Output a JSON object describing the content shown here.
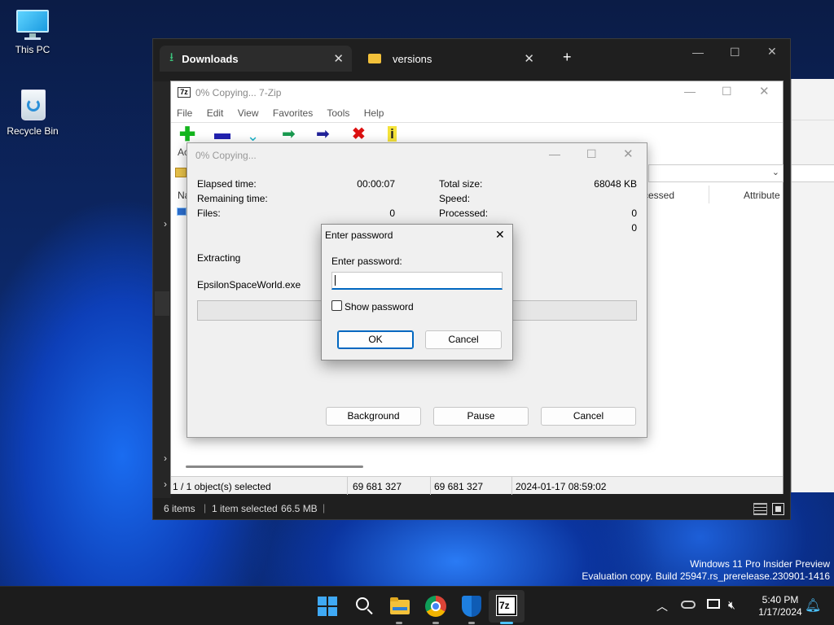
{
  "desktop": {
    "icons": [
      {
        "label": "This PC"
      },
      {
        "label": "Recycle Bin"
      }
    ],
    "watermark": {
      "line1": "Windows 11 Pro Insider Preview",
      "line2": "Evaluation copy. Build 25947.rs_prerelease.230901-1416"
    }
  },
  "explorer": {
    "tabs": [
      {
        "label": "Downloads",
        "close": "✕"
      },
      {
        "label": "versions",
        "close": "✕"
      }
    ],
    "new_tab": "+",
    "controls": {
      "minimize": "—",
      "maximize": "☐",
      "close": "✕"
    },
    "status": {
      "items": "6 items",
      "selected": "1 item selected",
      "size": "66.5 MB",
      "sep": "|"
    }
  },
  "sevenzip": {
    "title": "0% Copying... 7-Zip",
    "app_icon": "7z",
    "menu": [
      "File",
      "Edit",
      "View",
      "Favorites",
      "Tools",
      "Help"
    ],
    "toolbar": [
      "add-icon",
      "extract-icon",
      "test-icon",
      "copy-icon",
      "move-icon",
      "delete-icon",
      "info-icon"
    ],
    "toolbar_label_fragment": "Ac",
    "columns": {
      "name_fragment": "Na",
      "processed_fragment": "cessed",
      "attributes": "Attribute"
    },
    "statusbar": {
      "selected": "1 / 1 object(s) selected",
      "size": "69 681 327",
      "packed": "69 681 327",
      "modified": "2024-01-17 08:59:02"
    }
  },
  "progress": {
    "title": "0% Copying...",
    "left": [
      {
        "label": "Elapsed time:",
        "value": "00:00:07"
      },
      {
        "label": "Remaining time:",
        "value": ""
      },
      {
        "label": "Files:",
        "value": "0"
      }
    ],
    "right": [
      {
        "label": "Total size:",
        "value": "68048 KB"
      },
      {
        "label": "Speed:",
        "value": ""
      },
      {
        "label": "Processed:",
        "value": "0"
      },
      {
        "label": "",
        "value": "0"
      }
    ],
    "operation": "Extracting",
    "file": "EpsilonSpaceWorld.exe",
    "percent": 0,
    "buttons": {
      "background": "Background",
      "pause": "Pause",
      "cancel": "Cancel"
    }
  },
  "password_dialog": {
    "title": "Enter password",
    "close": "✕",
    "prompt": "Enter password:",
    "value": "",
    "show_password": "Show password",
    "show_checked": false,
    "ok": "OK",
    "cancel": "Cancel"
  },
  "taskbar": {
    "apps": [
      "windows-start-icon",
      "search-icon",
      "file-explorer-icon",
      "chrome-icon",
      "defender-icon",
      "7zip-icon"
    ],
    "clock": {
      "time": "5:40 PM",
      "date": "1/17/2024"
    }
  },
  "colors": {
    "accent": "#0067c0",
    "dialog_bg": "#f0f0f0",
    "explorer_bg": "#1f1f1f",
    "taskbar_bg": "#1c1c1c"
  }
}
